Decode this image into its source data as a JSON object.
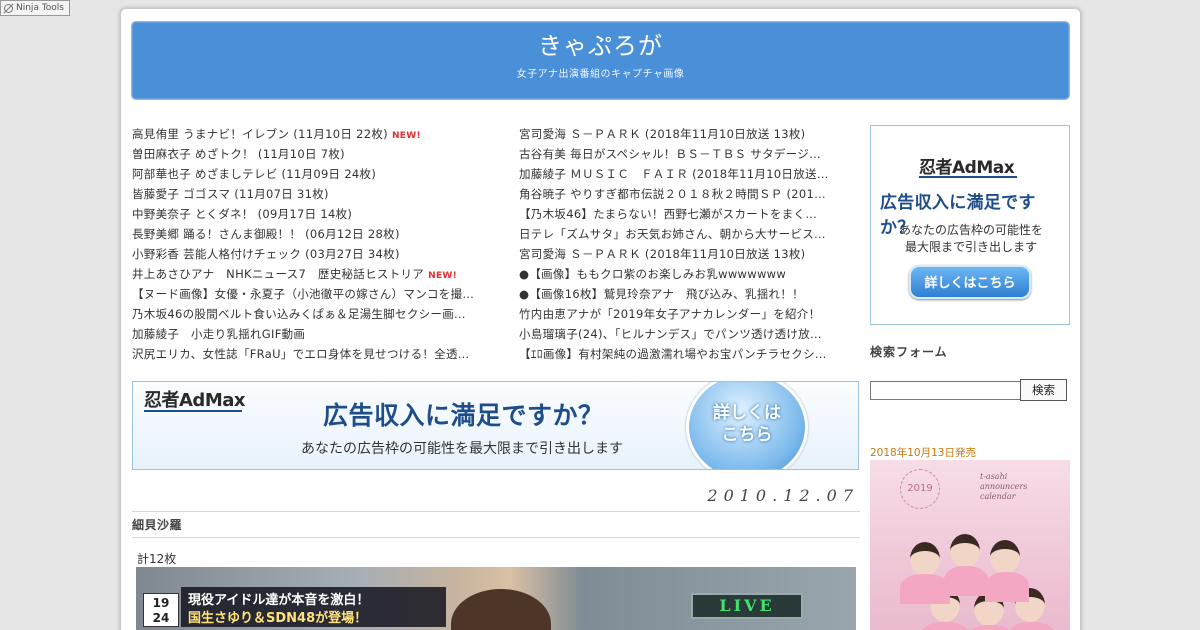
{
  "ninja_tools": {
    "label": "Ninja Tools"
  },
  "header": {
    "title": "きゃぷろが",
    "description": "女子アナ出演番組のキャプチャ画像"
  },
  "links_left": [
    {
      "text": "高見侑里 うまナビ！イレブン (11月10日 22枚)",
      "badge": "NEW!"
    },
    {
      "text": "曽田麻衣子 めざトク！ (11月10日 7枚)",
      "badge": ""
    },
    {
      "text": "阿部華也子 めざましテレビ (11月09日 24枚)",
      "badge": ""
    },
    {
      "text": "皆藤愛子 ゴゴスマ (11月07日 31枚)",
      "badge": ""
    },
    {
      "text": "中野美奈子 とくダネ！ (09月17日 14枚)",
      "badge": ""
    },
    {
      "text": "長野美郷 踊る！さんま御殿！！ (06月12日 28枚)",
      "badge": ""
    },
    {
      "text": "小野彩香 芸能人格付けチェック (03月27日 34枚)",
      "badge": ""
    },
    {
      "text": "井上あさひアナ　NHKニュース7　歴史秘話ヒストリア",
      "badge": "NEW!"
    },
    {
      "text": "【ヌード画像】女優・永夏子（小池徹平の嫁さん）マンコを撮…",
      "badge": ""
    },
    {
      "text": "乃木坂46の股間ベルト食い込みくぱぁ＆足湯生脚セクシー画像 …",
      "badge": ""
    },
    {
      "text": "加藤綾子　小走り乳揺れGIF動画",
      "badge": ""
    },
    {
      "text": "沢尻エリカ、女性誌「FRaU」でエロ身体を見せつける！全透け…",
      "badge": ""
    }
  ],
  "links_right": [
    {
      "text": "宮司愛海 Ｓ－ＰＡＲＫ (2018年11月10日放送 13枚)"
    },
    {
      "text": "古谷有美 毎日がスペシャル！ＢＳ－ＴＢＳ サタデージ…"
    },
    {
      "text": "加藤綾子 ＭＵＳＩＣ　ＦＡＩＲ (2018年11月10日放送…"
    },
    {
      "text": "角谷暁子 やりすぎ都市伝説２０１８秋２時間ＳＰ (201…"
    },
    {
      "text": "【乃木坂46】たまらない！西野七瀬がスカートをまく…"
    },
    {
      "text": "日テレ「ズムサタ」お天気お姉さん、朝から大サービス…"
    },
    {
      "text": "宮司愛海 Ｓ－ＰＡＲＫ (2018年11月10日放送 13枚)"
    },
    {
      "text": "●【画像】ももクロ紫のお楽しみお乳wwwwwww"
    },
    {
      "text": "●【画像16枚】鷲見玲奈アナ　飛び込み、乳揺れ！！"
    },
    {
      "text": "竹内由恵アナが「2019年女子アナカレンダー」を紹介！"
    },
    {
      "text": "小島瑠璃子(24)、「ヒルナンデス」でパンツ透け透け放…"
    },
    {
      "text": "【ｴﾛ画像】有村架純の過激濡れ場やお宝パンチラセクシ…"
    }
  ],
  "ad_banner": {
    "logo": "忍者AdMax",
    "headline": "広告収入に満足ですか？",
    "subtext": "あなたの広告枠の可能性を最大限まで引き出します",
    "button": "詳しくは\nこちら"
  },
  "post": {
    "date": "2010.12.07",
    "title": "細貝沙羅",
    "count": "計12枚"
  },
  "screenshot": {
    "channel": "19\n24",
    "caption_line1": "現役アイドル達が本音を激白！",
    "caption_line2": "国生さゆり＆SDN48が登場！",
    "live": "LIVE"
  },
  "sidebar_ad": {
    "logo": "忍者AdMax",
    "headline": "広告収入に満足ですか？",
    "subtext": "あなたの広告枠の可能性を\n最大限まで引き出します",
    "button": "詳しくはこちら"
  },
  "search": {
    "heading": "検索フォーム",
    "value": "",
    "button": "検索"
  },
  "calendar": {
    "release": "2018年10月13日発売",
    "year_badge": "2019",
    "title": "t-asahi\nannouncers\ncalendar"
  },
  "colors": {
    "header_bg": "#4a90d9",
    "new_badge": "#e03030",
    "release_label": "#c7780f",
    "ad_blue": "#1e4d8c"
  }
}
